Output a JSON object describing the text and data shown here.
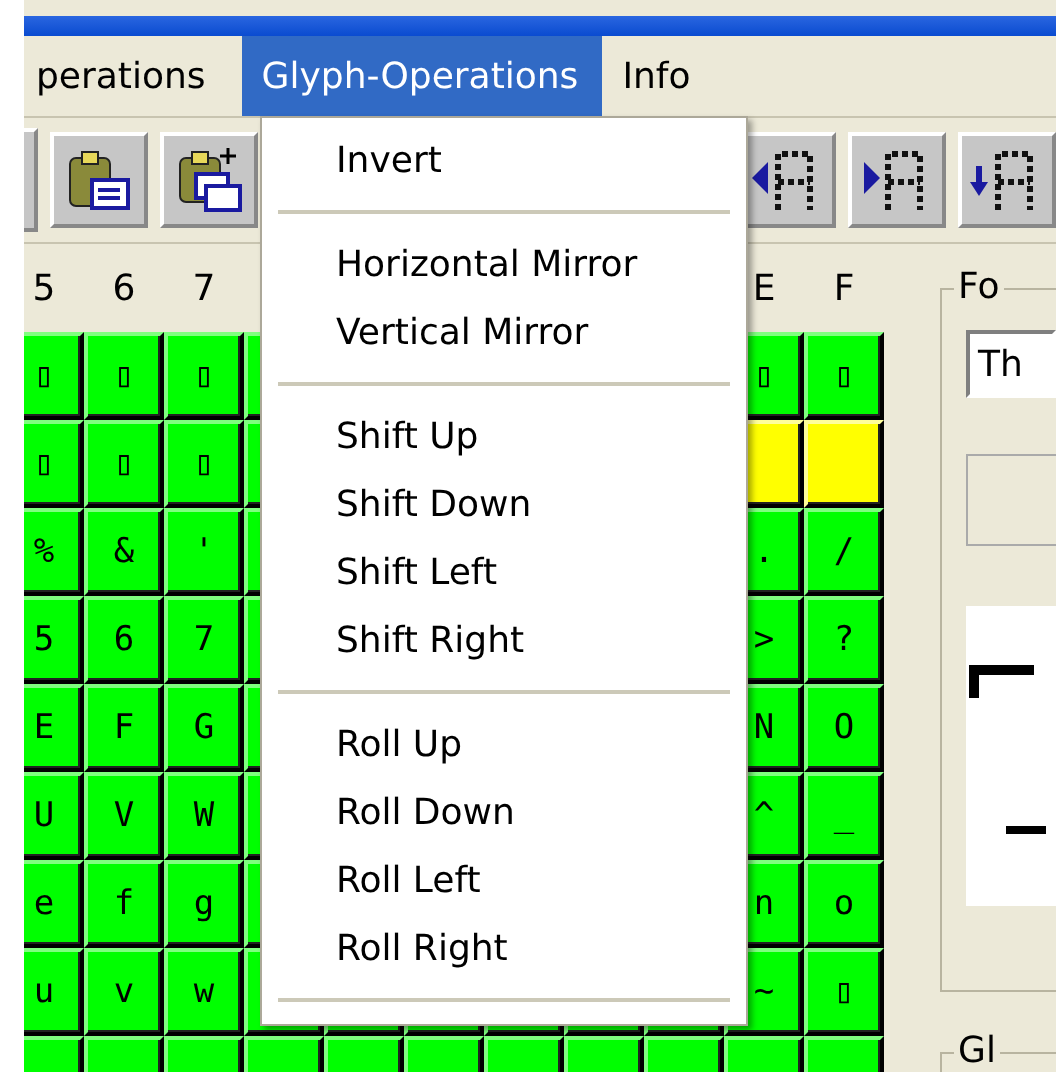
{
  "menu_bar": [
    {
      "label": "perations",
      "selected": false
    },
    {
      "label": "Glyph-Operations",
      "selected": true
    },
    {
      "label": "Info",
      "selected": false
    }
  ],
  "toolbar": {
    "left": [
      {
        "kind": "paste"
      },
      {
        "kind": "paste-plus"
      }
    ],
    "right": [
      {
        "kind": "left"
      },
      {
        "kind": "right"
      },
      {
        "kind": "down"
      }
    ]
  },
  "glyph_grid": {
    "left_columns": [
      "5",
      "6",
      "7"
    ],
    "right_columns": [
      "E",
      "F"
    ],
    "rows": [
      {
        "left": [
          {
            "char": "▯",
            "selected": false
          },
          {
            "char": "▯",
            "selected": false
          },
          {
            "char": "▯",
            "selected": false
          }
        ],
        "right": [
          {
            "char": "▯",
            "selected": false
          },
          {
            "char": "▯",
            "selected": false
          }
        ]
      },
      {
        "left": [
          {
            "char": "▯",
            "selected": false
          },
          {
            "char": "▯",
            "selected": false
          },
          {
            "char": "▯",
            "selected": false
          }
        ],
        "right": [
          {
            "selected": true
          },
          {
            "selected": true
          }
        ]
      },
      {
        "left": [
          {
            "char": "%",
            "selected": false
          },
          {
            "char": "&",
            "selected": false
          },
          {
            "char": "'",
            "selected": false
          }
        ],
        "right": [
          {
            "char": ".",
            "selected": false
          },
          {
            "char": "/",
            "selected": false
          }
        ]
      },
      {
        "left": [
          {
            "char": "5",
            "selected": false
          },
          {
            "char": "6",
            "selected": false
          },
          {
            "char": "7",
            "selected": false
          }
        ],
        "right": [
          {
            "char": ">",
            "selected": false
          },
          {
            "char": "?",
            "selected": false
          }
        ]
      },
      {
        "left": [
          {
            "char": "E",
            "selected": false
          },
          {
            "char": "F",
            "selected": false
          },
          {
            "char": "G",
            "selected": false
          }
        ],
        "right": [
          {
            "char": "N",
            "selected": false
          },
          {
            "char": "O",
            "selected": false
          }
        ]
      },
      {
        "left": [
          {
            "char": "U",
            "selected": false
          },
          {
            "char": "V",
            "selected": false
          },
          {
            "char": "W",
            "selected": false
          }
        ],
        "right": [
          {
            "char": "^",
            "selected": false
          },
          {
            "char": "_",
            "selected": false
          }
        ]
      },
      {
        "left": [
          {
            "char": "e",
            "selected": false
          },
          {
            "char": "f",
            "selected": false
          },
          {
            "char": "g",
            "selected": false
          }
        ],
        "right": [
          {
            "char": "n",
            "selected": false
          },
          {
            "char": "o",
            "selected": false
          }
        ]
      },
      {
        "left": [
          {
            "char": "u",
            "selected": false
          },
          {
            "char": "v",
            "selected": false
          },
          {
            "char": "w",
            "selected": false
          }
        ],
        "right": [
          {
            "char": "~",
            "selected": false
          },
          {
            "char": "▯",
            "selected": false
          }
        ]
      }
    ]
  },
  "font_group": {
    "legend": "Fo",
    "field_value": "Th"
  },
  "glyph_group": {
    "legend": "Gl"
  },
  "dropdown": [
    {
      "kind": "item",
      "label": "Invert"
    },
    {
      "kind": "separator"
    },
    {
      "kind": "item",
      "label": "Horizontal Mirror"
    },
    {
      "kind": "item",
      "label": "Vertical Mirror"
    },
    {
      "kind": "separator"
    },
    {
      "kind": "item",
      "label": "Shift Up"
    },
    {
      "kind": "item",
      "label": "Shift Down"
    },
    {
      "kind": "item",
      "label": "Shift Left"
    },
    {
      "kind": "item",
      "label": "Shift Right"
    },
    {
      "kind": "separator"
    },
    {
      "kind": "item",
      "label": "Roll Up"
    },
    {
      "kind": "item",
      "label": "Roll Down"
    },
    {
      "kind": "item",
      "label": "Roll Left"
    },
    {
      "kind": "item",
      "label": "Roll Right"
    },
    {
      "kind": "separator"
    }
  ]
}
